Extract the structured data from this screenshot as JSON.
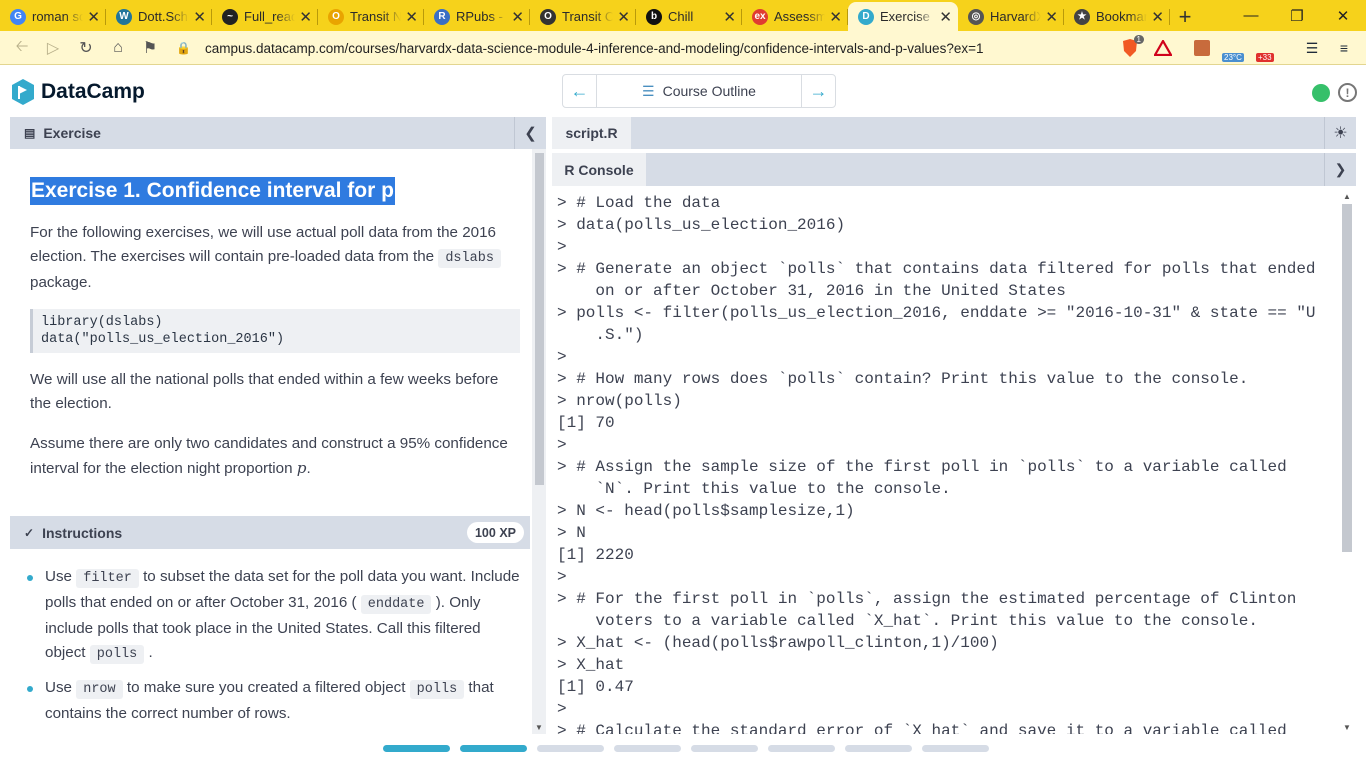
{
  "browser": {
    "tabs": [
      {
        "title": "roman sc",
        "favicon": "google-icon",
        "color": "#4285f4",
        "glyph": "G"
      },
      {
        "title": "Dott.Schu",
        "favicon": "wordpress-icon",
        "color": "#21759b",
        "glyph": "W"
      },
      {
        "title": "Full_read",
        "favicon": "wave-icon",
        "color": "#222222",
        "glyph": "~"
      },
      {
        "title": "Transit N",
        "favicon": "ring-icon",
        "color": "#e9a400",
        "glyph": "O"
      },
      {
        "title": "RPubs - F",
        "favicon": "rpubs-icon",
        "color": "#3b6fc4",
        "glyph": "R"
      },
      {
        "title": "Transit Cl",
        "favicon": "transit-icon",
        "color": "#333333",
        "glyph": "O"
      },
      {
        "title": "Chill",
        "favicon": "chill-icon",
        "color": "#111111",
        "glyph": "b"
      },
      {
        "title": "Assessme",
        "favicon": "edx-icon",
        "color": "#e03c31",
        "glyph": "ex"
      },
      {
        "title": "Exercise",
        "favicon": "datacamp-icon",
        "color": "#3ac",
        "glyph": "D"
      },
      {
        "title": "HarvardX",
        "favicon": "globe-icon",
        "color": "#555555",
        "glyph": "◎"
      },
      {
        "title": "Bookmar",
        "favicon": "star-icon",
        "color": "#444444",
        "glyph": "★"
      }
    ],
    "active_tab": 8,
    "url": "campus.datacamp.com/courses/harvardx-data-science-module-4-inference-and-modeling/confidence-intervals-and-p-values?ex=1",
    "weather": "23°C",
    "badge_count": "+33",
    "brave_count": "1"
  },
  "header": {
    "logo": "DataCamp",
    "course_outline": "Course Outline"
  },
  "exercise": {
    "bar_label": "Exercise",
    "title": "Exercise 1. Confidence interval for p",
    "para1_a": "For the following exercises, we will use actual poll data from the 2016 election. The exercises will contain pre-loaded data from the ",
    "para1_code": "dslabs",
    "para1_b": " package.",
    "code": "library(dslabs)\ndata(\"polls_us_election_2016\")",
    "para2": "We will use all the national polls that ended within a few weeks before the election.",
    "para3_a": "Assume there are only two candidates and construct a 95% confidence interval for the election night proportion ",
    "para3_var": "p",
    "para3_b": "."
  },
  "instructions": {
    "bar_label": "Instructions",
    "xp": "100 XP",
    "b1_a": "Use ",
    "b1_code1": "filter",
    "b1_b": " to subset the data set for the poll data you want. Include polls that ended on or after October 31, 2016 ( ",
    "b1_code2": "enddate",
    "b1_c": " ). Only include polls that took place in the United States. Call this filtered object ",
    "b1_code3": "polls",
    "b1_d": " .",
    "b2_a": "Use ",
    "b2_code1": "nrow",
    "b2_b": " to make sure you created a filtered object ",
    "b2_code2": "polls",
    "b2_c": " that contains the correct number of rows."
  },
  "editor": {
    "script_tab": "script.R",
    "console_tab": "R Console"
  },
  "console_lines": [
    "> # Load the data",
    "> data(polls_us_election_2016)",
    ">",
    "> # Generate an object `polls` that contains data filtered for polls that ended",
    "    on or after October 31, 2016 in the United States",
    "> polls <- filter(polls_us_election_2016, enddate >= \"2016-10-31\" & state == \"U",
    "    .S.\")",
    ">",
    "> # How many rows does `polls` contain? Print this value to the console.",
    "> nrow(polls)",
    "[1] 70",
    ">",
    "> # Assign the sample size of the first poll in `polls` to a variable called",
    "    `N`. Print this value to the console.",
    "> N <- head(polls$samplesize,1)",
    "> N",
    "[1] 2220",
    ">",
    "> # For the first poll in `polls`, assign the estimated percentage of Clinton",
    "    voters to a variable called `X_hat`. Print this value to the console.",
    "> X_hat <- (head(polls$rawpoll_clinton,1)/100)",
    "> X_hat",
    "[1] 0.47",
    ">",
    "> # Calculate the standard error of `X_hat` and save it to a variable called"
  ],
  "progress": {
    "segments": 8,
    "completed": 2
  },
  "colors": {
    "accent": "#33aacc",
    "chrome": "#f6d21b",
    "status": "#36c06a",
    "highlight": "#2f7be0"
  }
}
